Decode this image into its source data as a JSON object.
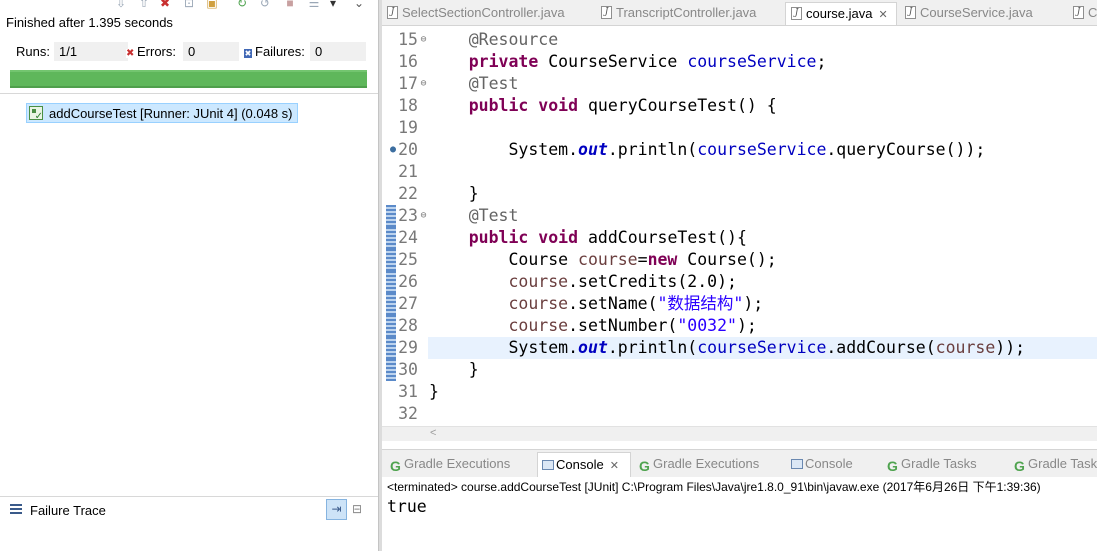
{
  "junit": {
    "toolbar_icons": [
      "next-failure-icon",
      "previous-failure-icon",
      "show-failures-only-icon",
      "scroll-lock-icon",
      "history-icon",
      "rerun-test-icon",
      "rerun-failed-first-icon",
      "stop-icon",
      "test-run-history-icon",
      "view-menu-icon"
    ],
    "status": "Finished after 1.395 seconds",
    "runs_label": "Runs:",
    "runs_value": "1/1",
    "errors_label": "Errors:",
    "errors_value": "0",
    "failures_label": "Failures:",
    "failures_value": "0",
    "progress": 1.0,
    "progress_color": "#5fb75b",
    "test_item": "addCourseTest [Runner: JUnit 4] (0.048 s)",
    "failure_trace_label": "Failure Trace"
  },
  "editor": {
    "tabs": [
      {
        "label": "SelectSectionController.java",
        "active": false
      },
      {
        "label": "TranscriptController.java",
        "active": false
      },
      {
        "label": "course.java",
        "active": true
      },
      {
        "label": "CourseService.java",
        "active": false
      },
      {
        "label": "Cou",
        "active": false
      }
    ],
    "lines": [
      {
        "num": "15",
        "fold": "⊖",
        "parts": [
          [
            "",
            "    "
          ],
          [
            "an",
            "@Resource"
          ]
        ]
      },
      {
        "num": "16",
        "parts": [
          [
            "",
            "    "
          ],
          [
            "kw",
            "private"
          ],
          [
            "",
            " CourseService "
          ],
          [
            "fld",
            "courseService"
          ],
          [
            "",
            ";"
          ]
        ]
      },
      {
        "num": "17",
        "fold": "⊖",
        "parts": [
          [
            "",
            "    "
          ],
          [
            "an",
            "@Test"
          ]
        ]
      },
      {
        "num": "18",
        "parts": [
          [
            "",
            "    "
          ],
          [
            "kw",
            "public"
          ],
          [
            "",
            " "
          ],
          [
            "kw",
            "void"
          ],
          [
            "",
            " queryCourseTest() {"
          ]
        ]
      },
      {
        "num": "19",
        "parts": []
      },
      {
        "num": "20",
        "marker": "●",
        "parts": [
          [
            "",
            "        System."
          ],
          [
            "st",
            "out"
          ],
          [
            "",
            ".println("
          ],
          [
            "fld",
            "courseService"
          ],
          [
            "",
            ".queryCourse());"
          ]
        ]
      },
      {
        "num": "21",
        "parts": []
      },
      {
        "num": "22",
        "parts": [
          [
            "",
            "    }"
          ]
        ]
      },
      {
        "num": "23",
        "fold": "⊖",
        "change": true,
        "parts": [
          [
            "",
            "    "
          ],
          [
            "an",
            "@Test"
          ]
        ]
      },
      {
        "num": "24",
        "change": true,
        "parts": [
          [
            "",
            "    "
          ],
          [
            "kw",
            "public"
          ],
          [
            "",
            " "
          ],
          [
            "kw",
            "void"
          ],
          [
            "",
            " addCourseTest(){"
          ]
        ]
      },
      {
        "num": "25",
        "change": true,
        "parts": [
          [
            "",
            "        Course "
          ],
          [
            "lv",
            "course"
          ],
          [
            "",
            "="
          ],
          [
            "kw",
            "new"
          ],
          [
            "",
            " Course();"
          ]
        ]
      },
      {
        "num": "26",
        "change": true,
        "parts": [
          [
            "",
            "        "
          ],
          [
            "lv",
            "course"
          ],
          [
            "",
            ".setCredits(2.0);"
          ]
        ]
      },
      {
        "num": "27",
        "change": true,
        "parts": [
          [
            "",
            "        "
          ],
          [
            "lv",
            "course"
          ],
          [
            "",
            ".setName("
          ],
          [
            "str",
            "\"数据结构\""
          ],
          [
            "",
            ");"
          ]
        ]
      },
      {
        "num": "28",
        "change": true,
        "parts": [
          [
            "",
            "        "
          ],
          [
            "lv",
            "course"
          ],
          [
            "",
            ".setNumber("
          ],
          [
            "str",
            "\"0032\""
          ],
          [
            "",
            ");"
          ]
        ]
      },
      {
        "num": "29",
        "change": true,
        "current": true,
        "parts": [
          [
            "",
            "        System."
          ],
          [
            "st",
            "out"
          ],
          [
            "",
            ".println("
          ],
          [
            "fld",
            "courseService"
          ],
          [
            "",
            ".addCourse("
          ],
          [
            "lv",
            "course"
          ],
          [
            "",
            "));"
          ]
        ]
      },
      {
        "num": "30",
        "change": true,
        "parts": [
          [
            "",
            "    }"
          ]
        ]
      },
      {
        "num": "31",
        "parts": [
          [
            "",
            "}"
          ]
        ]
      },
      {
        "num": "32",
        "parts": []
      }
    ],
    "hscroll_arrow": "<"
  },
  "console": {
    "tabs": [
      {
        "label": "Gradle Executions",
        "icon": "gradle-icon",
        "active": false
      },
      {
        "label": "Console",
        "icon": "console-icon",
        "active": true,
        "close": "✕"
      },
      {
        "label": "Gradle Executions",
        "icon": "gradle-icon",
        "active": false
      },
      {
        "label": "Console",
        "icon": "console-icon",
        "active": false
      },
      {
        "label": "Gradle Tasks",
        "icon": "gradle-icon",
        "active": false
      },
      {
        "label": "Gradle Task",
        "icon": "gradle-icon",
        "active": false
      }
    ],
    "header": "<terminated> course.addCourseTest [JUnit] C:\\Program Files\\Java\\jre1.8.0_91\\bin\\javaw.exe (2017年6月26日 下午1:39:36)",
    "output": "true"
  }
}
